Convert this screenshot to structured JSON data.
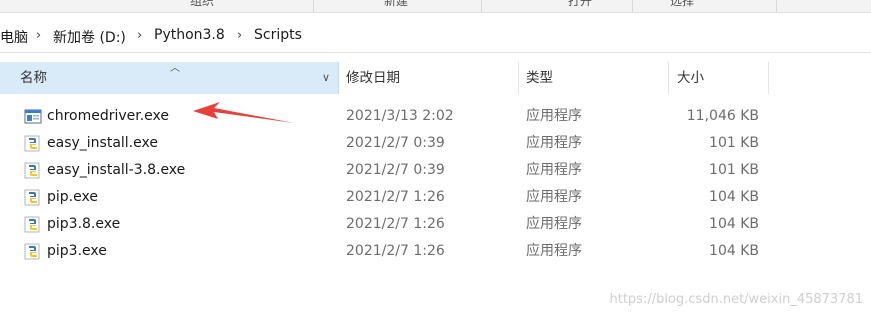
{
  "toolbar": {
    "labels": [
      "组织",
      "新建",
      "打开",
      "选择"
    ]
  },
  "address": {
    "crumbs": [
      "电脑",
      "新加卷 (D:)",
      "Python3.8",
      "Scripts"
    ]
  },
  "columns": {
    "name": "名称",
    "date": "修改日期",
    "type": "类型",
    "size": "大小"
  },
  "files": [
    {
      "name": "chromedriver.exe",
      "date": "2021/3/13 2:02",
      "type": "应用程序",
      "size": "11,046 KB",
      "icon": "application-window-icon"
    },
    {
      "name": "easy_install.exe",
      "date": "2021/2/7 0:39",
      "type": "应用程序",
      "size": "101 KB",
      "icon": "python-icon"
    },
    {
      "name": "easy_install-3.8.exe",
      "date": "2021/2/7 0:39",
      "type": "应用程序",
      "size": "101 KB",
      "icon": "python-icon"
    },
    {
      "name": "pip.exe",
      "date": "2021/2/7 1:26",
      "type": "应用程序",
      "size": "104 KB",
      "icon": "python-icon"
    },
    {
      "name": "pip3.8.exe",
      "date": "2021/2/7 1:26",
      "type": "应用程序",
      "size": "104 KB",
      "icon": "python-icon"
    },
    {
      "name": "pip3.exe",
      "date": "2021/2/7 1:26",
      "type": "应用程序",
      "size": "104 KB",
      "icon": "python-icon"
    }
  ],
  "annotation": {
    "arrow_color": "#e8403a"
  },
  "watermark": "https://blog.csdn.net/weixin_45873781"
}
